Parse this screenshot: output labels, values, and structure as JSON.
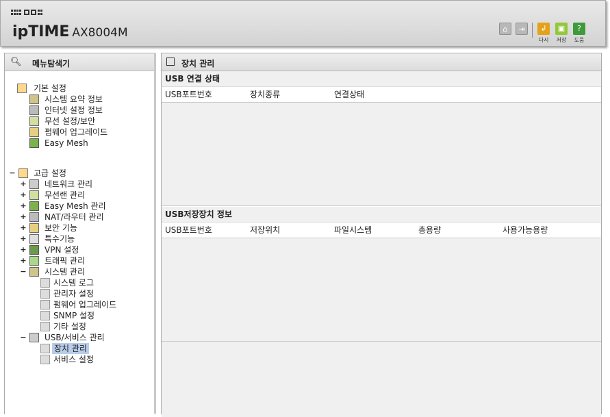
{
  "header": {
    "brand": "ipTIME",
    "model": "AX8004M",
    "buttons": [
      {
        "label": "다시",
        "color": "#e3a21a"
      },
      {
        "label": "저장",
        "color": "#93c83a"
      },
      {
        "label": "도움",
        "color": "#3f9b3a"
      }
    ]
  },
  "left": {
    "title": "메뉴탐색기",
    "basic": {
      "label": "기본 설정",
      "items": [
        "시스템 요약 정보",
        "인터넷 설정 정보",
        "무선 설정/보안",
        "펌웨어 업그레이드",
        "Easy Mesh"
      ]
    },
    "advanced": {
      "label": "고급 설정",
      "items": [
        "네트워크 관리",
        "무선랜 관리",
        "Easy Mesh 관리",
        "NAT/라우터 관리",
        "보안 기능",
        "특수기능",
        "VPN 설정",
        "트래픽 관리"
      ],
      "system": {
        "label": "시스템 관리",
        "items": [
          "시스템 로그",
          "관리자 설정",
          "펌웨어 업그레이드",
          "SNMP 설정",
          "기타 설정"
        ]
      },
      "usb": {
        "label": "USB/서비스 관리",
        "items": [
          "장치 관리",
          "서비스 설정"
        ]
      }
    }
  },
  "right": {
    "title": "장치 관리",
    "usb_status": {
      "title": "USB 연결 상태",
      "columns": [
        "USB포트번호",
        "장치종류",
        "연결상태"
      ]
    },
    "usb_storage": {
      "title": "USB저장장치 정보",
      "columns": [
        "USB포트번호",
        "저장위치",
        "파일시스템",
        "총용량",
        "사용가능용량"
      ]
    }
  }
}
